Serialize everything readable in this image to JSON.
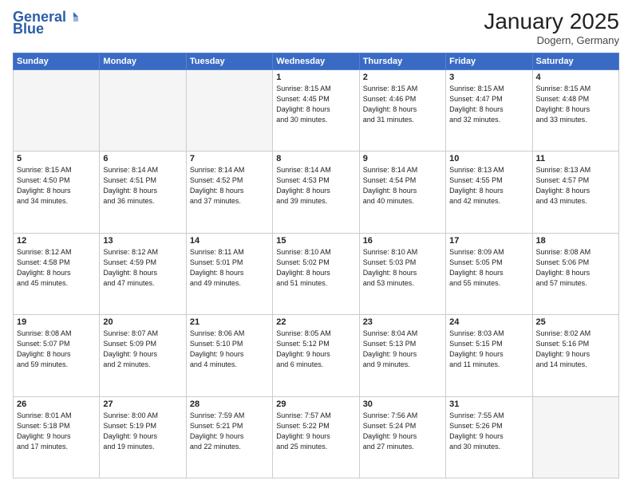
{
  "header": {
    "logo_general": "General",
    "logo_blue": "Blue",
    "month": "January 2025",
    "location": "Dogern, Germany"
  },
  "weekdays": [
    "Sunday",
    "Monday",
    "Tuesday",
    "Wednesday",
    "Thursday",
    "Friday",
    "Saturday"
  ],
  "weeks": [
    [
      {
        "day": "",
        "info": ""
      },
      {
        "day": "",
        "info": ""
      },
      {
        "day": "",
        "info": ""
      },
      {
        "day": "1",
        "info": "Sunrise: 8:15 AM\nSunset: 4:45 PM\nDaylight: 8 hours\nand 30 minutes."
      },
      {
        "day": "2",
        "info": "Sunrise: 8:15 AM\nSunset: 4:46 PM\nDaylight: 8 hours\nand 31 minutes."
      },
      {
        "day": "3",
        "info": "Sunrise: 8:15 AM\nSunset: 4:47 PM\nDaylight: 8 hours\nand 32 minutes."
      },
      {
        "day": "4",
        "info": "Sunrise: 8:15 AM\nSunset: 4:48 PM\nDaylight: 8 hours\nand 33 minutes."
      }
    ],
    [
      {
        "day": "5",
        "info": "Sunrise: 8:15 AM\nSunset: 4:50 PM\nDaylight: 8 hours\nand 34 minutes."
      },
      {
        "day": "6",
        "info": "Sunrise: 8:14 AM\nSunset: 4:51 PM\nDaylight: 8 hours\nand 36 minutes."
      },
      {
        "day": "7",
        "info": "Sunrise: 8:14 AM\nSunset: 4:52 PM\nDaylight: 8 hours\nand 37 minutes."
      },
      {
        "day": "8",
        "info": "Sunrise: 8:14 AM\nSunset: 4:53 PM\nDaylight: 8 hours\nand 39 minutes."
      },
      {
        "day": "9",
        "info": "Sunrise: 8:14 AM\nSunset: 4:54 PM\nDaylight: 8 hours\nand 40 minutes."
      },
      {
        "day": "10",
        "info": "Sunrise: 8:13 AM\nSunset: 4:55 PM\nDaylight: 8 hours\nand 42 minutes."
      },
      {
        "day": "11",
        "info": "Sunrise: 8:13 AM\nSunset: 4:57 PM\nDaylight: 8 hours\nand 43 minutes."
      }
    ],
    [
      {
        "day": "12",
        "info": "Sunrise: 8:12 AM\nSunset: 4:58 PM\nDaylight: 8 hours\nand 45 minutes."
      },
      {
        "day": "13",
        "info": "Sunrise: 8:12 AM\nSunset: 4:59 PM\nDaylight: 8 hours\nand 47 minutes."
      },
      {
        "day": "14",
        "info": "Sunrise: 8:11 AM\nSunset: 5:01 PM\nDaylight: 8 hours\nand 49 minutes."
      },
      {
        "day": "15",
        "info": "Sunrise: 8:10 AM\nSunset: 5:02 PM\nDaylight: 8 hours\nand 51 minutes."
      },
      {
        "day": "16",
        "info": "Sunrise: 8:10 AM\nSunset: 5:03 PM\nDaylight: 8 hours\nand 53 minutes."
      },
      {
        "day": "17",
        "info": "Sunrise: 8:09 AM\nSunset: 5:05 PM\nDaylight: 8 hours\nand 55 minutes."
      },
      {
        "day": "18",
        "info": "Sunrise: 8:08 AM\nSunset: 5:06 PM\nDaylight: 8 hours\nand 57 minutes."
      }
    ],
    [
      {
        "day": "19",
        "info": "Sunrise: 8:08 AM\nSunset: 5:07 PM\nDaylight: 8 hours\nand 59 minutes."
      },
      {
        "day": "20",
        "info": "Sunrise: 8:07 AM\nSunset: 5:09 PM\nDaylight: 9 hours\nand 2 minutes."
      },
      {
        "day": "21",
        "info": "Sunrise: 8:06 AM\nSunset: 5:10 PM\nDaylight: 9 hours\nand 4 minutes."
      },
      {
        "day": "22",
        "info": "Sunrise: 8:05 AM\nSunset: 5:12 PM\nDaylight: 9 hours\nand 6 minutes."
      },
      {
        "day": "23",
        "info": "Sunrise: 8:04 AM\nSunset: 5:13 PM\nDaylight: 9 hours\nand 9 minutes."
      },
      {
        "day": "24",
        "info": "Sunrise: 8:03 AM\nSunset: 5:15 PM\nDaylight: 9 hours\nand 11 minutes."
      },
      {
        "day": "25",
        "info": "Sunrise: 8:02 AM\nSunset: 5:16 PM\nDaylight: 9 hours\nand 14 minutes."
      }
    ],
    [
      {
        "day": "26",
        "info": "Sunrise: 8:01 AM\nSunset: 5:18 PM\nDaylight: 9 hours\nand 17 minutes."
      },
      {
        "day": "27",
        "info": "Sunrise: 8:00 AM\nSunset: 5:19 PM\nDaylight: 9 hours\nand 19 minutes."
      },
      {
        "day": "28",
        "info": "Sunrise: 7:59 AM\nSunset: 5:21 PM\nDaylight: 9 hours\nand 22 minutes."
      },
      {
        "day": "29",
        "info": "Sunrise: 7:57 AM\nSunset: 5:22 PM\nDaylight: 9 hours\nand 25 minutes."
      },
      {
        "day": "30",
        "info": "Sunrise: 7:56 AM\nSunset: 5:24 PM\nDaylight: 9 hours\nand 27 minutes."
      },
      {
        "day": "31",
        "info": "Sunrise: 7:55 AM\nSunset: 5:26 PM\nDaylight: 9 hours\nand 30 minutes."
      },
      {
        "day": "",
        "info": ""
      }
    ]
  ]
}
